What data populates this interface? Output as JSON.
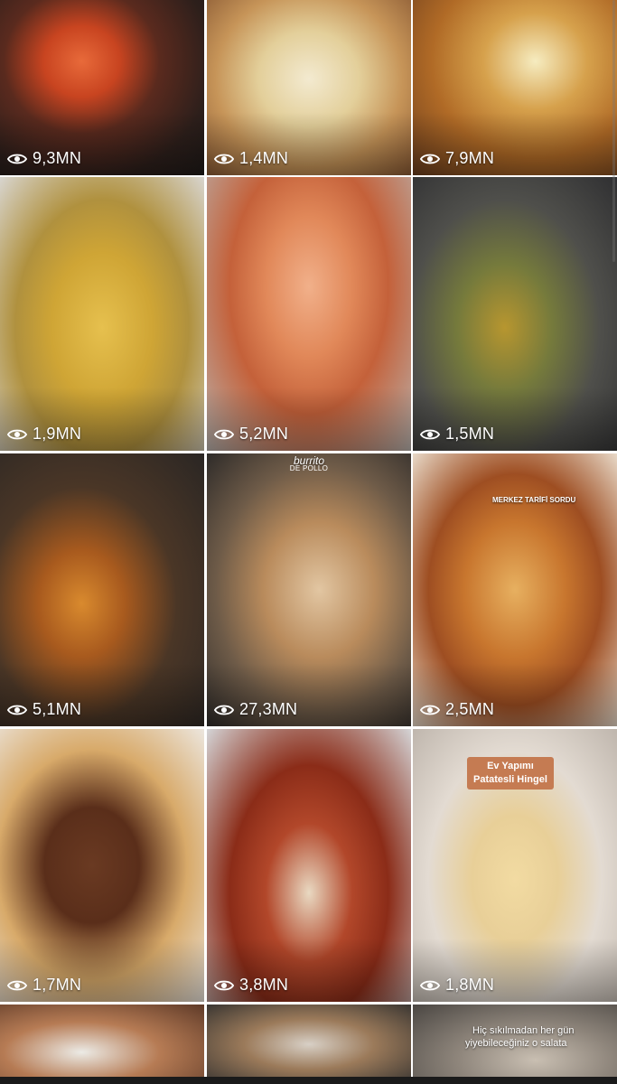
{
  "grid": {
    "tiles": [
      {
        "views": "9,3MN",
        "bg": "radial-gradient(ellipse at 40% 35%, #e86a3a 0%, #c84420 22%, #5a2a1e 45%, #2d1f1b 75%, #1f1a18 100%)"
      },
      {
        "views": "1,4MN",
        "bg": "radial-gradient(ellipse at 50% 45%, #f3ead0 0%, #e3cf9a 35%, #c69458 65%, #8a5a34 100%)"
      },
      {
        "views": "7,9MN",
        "bg": "radial-gradient(ellipse at 60% 35%, #f6ecc0 0%, #d6a14c 30%, #b06a26 60%, #6a3d1e 100%)"
      },
      {
        "views": "1,9MN",
        "bg": "radial-gradient(ellipse at 50% 55%, #e6c04e 0%, #cfa535 35%, #b0913e 60%, #d8d5cf 100%)"
      },
      {
        "views": "5,2MN",
        "bg": "radial-gradient(ellipse at 50% 40%, #f1b08a 0%, #e18859 30%, #c4613a 55%, #b9b2ad 100%)"
      },
      {
        "views": "1,5MN",
        "bg": "radial-gradient(ellipse at 45% 55%, #b7962f 0%, #757a3c 30%, #4f4f4b 60%, #2f2f31 100%)"
      },
      {
        "views": "5,1MN",
        "bg": "radial-gradient(ellipse at 40% 55%, #d98a2e 0%, #a85a1e 25%, #4a3626 55%, #2a2624 100%)"
      },
      {
        "views": "27,3MN",
        "bg": "radial-gradient(ellipse at 55% 50%, #e2c6a2 0%, #b98b5c 35%, #6e5b48 65%, #2e2b29 100%)"
      },
      {
        "views": "2,5MN",
        "bg": "radial-gradient(ellipse at 50% 50%, #e7b060 0%, #c8762e 35%, #9e4e22 60%, #e8d9c8 100%)"
      },
      {
        "views": "1,7MN",
        "bg": "radial-gradient(ellipse at 45% 50%, #6a3a22 0%, #5a2e1a 30%, #d8aa6a 60%, #ece6de 100%)"
      },
      {
        "views": "3,8MN",
        "bg": "radial-gradient(ellipse at 50% 60%, #e9d9c2 0%, #b2472a 30%, #8b2c18 55%, #d4d4d6 100%)"
      },
      {
        "views": "1,8MN",
        "bg": "radial-gradient(ellipse at 50% 55%, #f2dba2 0%, #e8cf98 30%, #e3dbd2 60%, #bfb6ad 100%)"
      },
      {
        "views": "",
        "bg": "radial-gradient(ellipse at 40% 60%, #ecebe6 0%, #b67b54 45%, #5e3a28 100%)"
      },
      {
        "views": "",
        "bg": "radial-gradient(ellipse at 50% 50%, #d8d0c6 0%, #9b7a5a 45%, #3a3632 100%)"
      },
      {
        "views": "",
        "bg": "radial-gradient(ellipse at 60% 70%, #c9bfb2 0%, #8e857b 45%, #4a4642 100%)"
      }
    ]
  },
  "overlays": {
    "burrito_brand": "burrito",
    "burrito_sub": "DE POLLO",
    "pide_caption": "MERKEZ TARİFİ SORDU",
    "hingel_label_line1": "Ev Yapımı",
    "hingel_label_line2": "Patatesli Hingel",
    "salad_caption_line1": "Hiç sıkılmadan her gün",
    "salad_caption_line2": "yiyebileceğiniz o salata"
  },
  "colors": {
    "divider": "#ffffff",
    "view_text": "#ffffff",
    "label_bg": "#c57b52"
  },
  "icons": {
    "views": "eye-icon"
  }
}
